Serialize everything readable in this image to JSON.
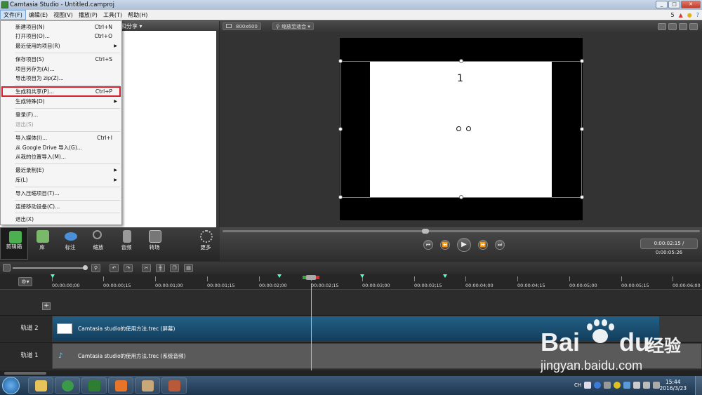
{
  "window": {
    "title": "Camtasia Studio - Untitled.camproj",
    "buttons": [
      "_",
      "□",
      "✕"
    ]
  },
  "menubar": {
    "items": [
      "文件(F)",
      "编辑(E)",
      "视图(V)",
      "播放(P)",
      "工具(T)",
      "帮助(H)"
    ],
    "right_badge": "5"
  },
  "file_menu": {
    "items": [
      {
        "label": "新建项目(N)",
        "shortcut": "Ctrl+N"
      },
      {
        "label": "打开项目(O)...",
        "shortcut": "Ctrl+O"
      },
      {
        "label": "最近使用的项目(R)",
        "submenu": "▶"
      },
      {
        "label": "保存项目(S)",
        "shortcut": "Ctrl+S"
      },
      {
        "label": "项目另存为(A)..."
      },
      {
        "label": "导出项目为 zip(Z)..."
      },
      {
        "label": "生成和共享(P)...",
        "shortcut": "Ctrl+P"
      },
      {
        "label": "生成特殊(D)",
        "submenu": "▶"
      },
      {
        "label": "登录(F)..."
      },
      {
        "label": "退出(S)"
      },
      {
        "label": "导入媒体(I)...",
        "shortcut": "Ctrl+I"
      },
      {
        "label": "从 Google Drive 导入(G)..."
      },
      {
        "label": "从我的位置导入(M)..."
      },
      {
        "label": "最近录制(E)",
        "submenu": "▶"
      },
      {
        "label": "库(L)",
        "submenu": "▶"
      },
      {
        "label": "导入压缩项目(T)..."
      },
      {
        "label": "连接移动设备(C)..."
      },
      {
        "label": "退出(X)"
      }
    ]
  },
  "left_panel": {
    "share_label": "和分享 ▾"
  },
  "preview": {
    "size_label": "800x600",
    "zoom_label": "缩放至适合 ▾",
    "canvas_text": "1"
  },
  "playback": {
    "buttons": [
      "⏮",
      "⏪",
      "▶",
      "⏩",
      "⏭"
    ],
    "time": "0:00:02:15 / 0:00:05:26"
  },
  "tool_tabs": [
    {
      "label": "剪辑箱",
      "color": "#4caf50"
    },
    {
      "label": "库",
      "color": "#7ab86a"
    },
    {
      "label": "标注",
      "color": "#4a90d9"
    },
    {
      "label": "缩放",
      "color": "#888888"
    },
    {
      "label": "音频",
      "color": "#999999"
    },
    {
      "label": "转场",
      "color": "#777777"
    },
    {
      "label": "更多",
      "color": "#bbbbbb"
    }
  ],
  "ruler": {
    "ticks": [
      "00:00:00;00",
      "00:00:00;15",
      "00:00:01;00",
      "00:00:01;15",
      "00:00:02;00",
      "00:00:02;15",
      "00:00:03;00",
      "00:00:03;15",
      "00:00:04;00",
      "00:00:04;15",
      "00:00:05;00",
      "00:00:05;15",
      "00:00:06;00"
    ]
  },
  "tracks": [
    {
      "name": "轨道 2",
      "clip": "Camtasia  studio的使用方法.trec (屏幕)"
    },
    {
      "name": "轨道 1",
      "clip": "Camtasia  studio的使用方法.trec (系统音频)"
    }
  ],
  "taskbar": {
    "clock_time": "15:44",
    "clock_date": "2016/3/23",
    "lang": "CH"
  },
  "watermark": {
    "logo_left": "Bai",
    "logo_right": "du",
    "cn": "经验",
    "url": "jingyan.baidu.com"
  }
}
